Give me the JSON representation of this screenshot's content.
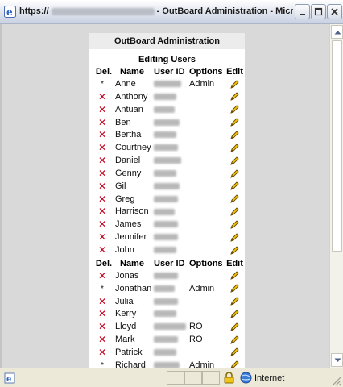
{
  "window": {
    "title_prefix": "https://",
    "title_suffix": "- OutBoard Administration - Micr...",
    "buttons": [
      "minimize",
      "maximize",
      "close"
    ]
  },
  "panel": {
    "header": "OutBoard Administration",
    "section_title": "Editing Users",
    "columns": {
      "del": "Del.",
      "name": "Name",
      "user_id": "User ID",
      "options": "Options",
      "edit": "Edit"
    }
  },
  "users": [
    {
      "del": "*",
      "name": "Anne",
      "options": "Admin"
    },
    {
      "del": "x",
      "name": "Anthony",
      "options": ""
    },
    {
      "del": "x",
      "name": "Antuan",
      "options": ""
    },
    {
      "del": "x",
      "name": "Ben",
      "options": ""
    },
    {
      "del": "x",
      "name": "Bertha",
      "options": ""
    },
    {
      "del": "x",
      "name": "Courtney",
      "options": ""
    },
    {
      "del": "x",
      "name": "Daniel",
      "options": ""
    },
    {
      "del": "x",
      "name": "Genny",
      "options": ""
    },
    {
      "del": "x",
      "name": "Gil",
      "options": ""
    },
    {
      "del": "x",
      "name": "Greg",
      "options": ""
    },
    {
      "del": "x",
      "name": "Harrison",
      "options": ""
    },
    {
      "del": "x",
      "name": "James",
      "options": ""
    },
    {
      "del": "x",
      "name": "Jennifer",
      "options": ""
    },
    {
      "del": "x",
      "name": "John",
      "options": ""
    },
    {
      "header": true
    },
    {
      "del": "x",
      "name": "Jonas",
      "options": ""
    },
    {
      "del": "*",
      "name": "Jonathan",
      "options": "Admin"
    },
    {
      "del": "x",
      "name": "Julia",
      "options": ""
    },
    {
      "del": "x",
      "name": "Kerry",
      "options": ""
    },
    {
      "del": "x",
      "name": "Lloyd",
      "options": "RO"
    },
    {
      "del": "x",
      "name": "Mark",
      "options": "RO"
    },
    {
      "del": "x",
      "name": "Patrick",
      "options": ""
    },
    {
      "del": "*",
      "name": "Richard",
      "options": "Admin"
    }
  ],
  "status": {
    "zone": "Internet"
  },
  "colors": {
    "delete": "#c4001c",
    "pencil": "#e8b400"
  }
}
